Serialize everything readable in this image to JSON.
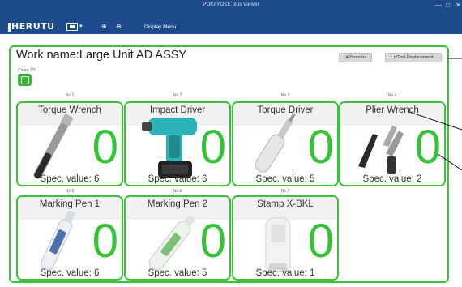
{
  "window": {
    "title": "POKAYOKE plus Viewer",
    "min": "—",
    "max": "□",
    "close": "✕"
  },
  "toolbar": {
    "logo": "HERUTU",
    "display_caret": "▾",
    "zoom_in_glyph": "⊕",
    "zoom_out_glyph": "⊖",
    "display_menu": "Display Menu"
  },
  "work": {
    "title": "Work name:Large Unit AD ASSY",
    "count_label": "Count 1/3",
    "zoom_in_button": "⊕Zoom In",
    "tool_replacement_button": "⇄Tool Replacement"
  },
  "tools": [
    {
      "no": "No.1",
      "name": "Torque Wrench",
      "count": "0",
      "spec": "Spec. value: 6"
    },
    {
      "no": "No.2",
      "name": "Impact Driver",
      "count": "0",
      "spec": "Spec. value: 6"
    },
    {
      "no": "No.3",
      "name": "Torque Driver",
      "count": "0",
      "spec": "Spec. value: 5"
    },
    {
      "no": "No.4",
      "name": "Plier Wrench",
      "count": "0",
      "spec": "Spec. value: 2"
    },
    {
      "no": "No.5",
      "name": "Marking Pen 1",
      "count": "0",
      "spec": "Spec. value: 6"
    },
    {
      "no": "No.6",
      "name": "Marking Pen 2",
      "count": "0",
      "spec": "Spec. value: 5"
    },
    {
      "no": "No.7",
      "name": "Stamp X-BKL",
      "count": "0",
      "spec": "Spec. value: 1"
    }
  ],
  "colors": {
    "toolbar": "#1d4a8a",
    "accent_green": "#3cc23a",
    "count_green": "#36c236"
  }
}
